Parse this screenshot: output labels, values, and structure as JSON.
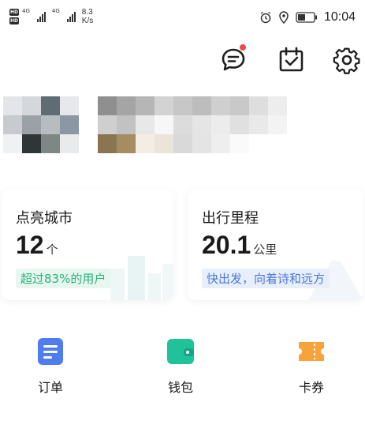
{
  "status_bar": {
    "hd_badge": "HD",
    "network_1": "4G",
    "network_2": "4G",
    "speed_value": "8.3",
    "speed_unit": "K/s",
    "time": "10:04"
  },
  "header": {
    "icons": [
      "message-icon",
      "checkin-calendar-icon",
      "settings-gear-icon"
    ],
    "notification_dot_color": "#f5484b"
  },
  "stats": {
    "cities": {
      "label": "点亮城市",
      "value": "12",
      "unit": "个",
      "badge": "超过83%的用户"
    },
    "mileage": {
      "label": "出行里程",
      "value": "20.1",
      "unit": "公里",
      "badge": "快出发，向着诗和远方"
    }
  },
  "shortcuts": [
    {
      "label": "订单",
      "icon": "order-list-icon",
      "color": "#4f7df0"
    },
    {
      "label": "钱包",
      "icon": "wallet-icon",
      "color": "#20c29a"
    },
    {
      "label": "卡券",
      "icon": "coupon-ticket-icon",
      "color": "#f7a33a"
    }
  ]
}
